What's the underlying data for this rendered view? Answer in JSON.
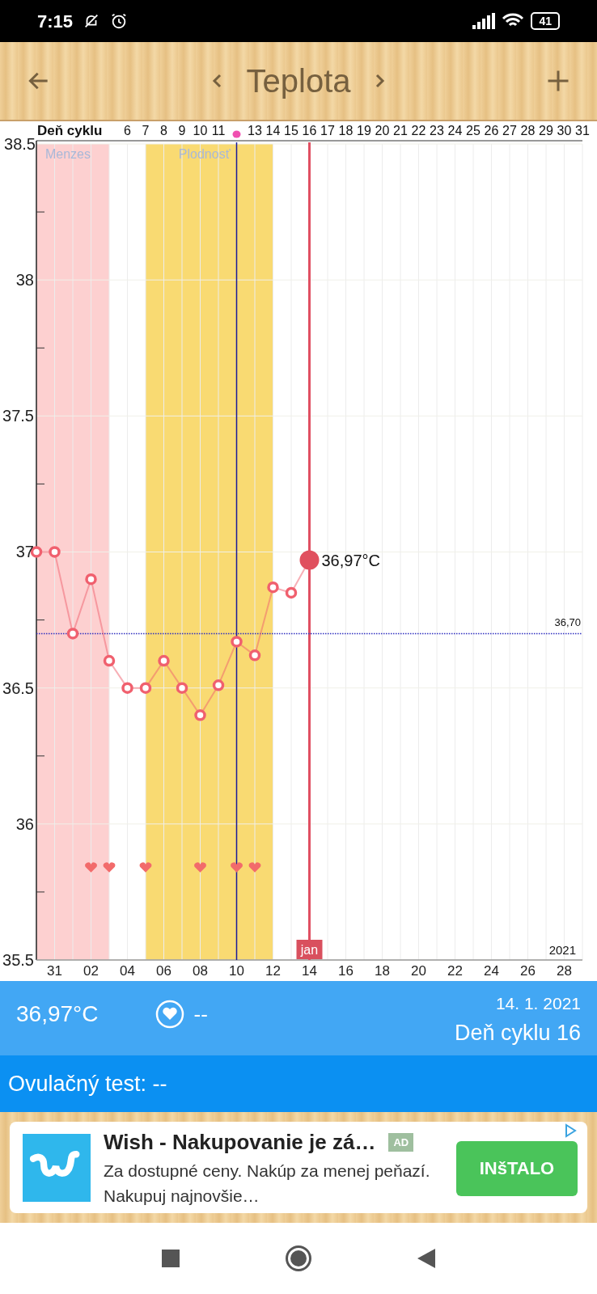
{
  "status_bar": {
    "time": "7:15",
    "battery": "41"
  },
  "header": {
    "title": "Teplota"
  },
  "chart": {
    "cycle_axis_title": "Deň cyklu",
    "cycle_day_labels": [
      {
        "kind": "number",
        "label": "6"
      },
      {
        "kind": "number",
        "label": "7"
      },
      {
        "kind": "number",
        "label": "8"
      },
      {
        "kind": "number",
        "label": "9"
      },
      {
        "kind": "number",
        "label": "10"
      },
      {
        "kind": "number",
        "label": "11"
      },
      {
        "kind": "ovulation"
      },
      {
        "kind": "number",
        "label": "13"
      },
      {
        "kind": "number",
        "label": "14"
      },
      {
        "kind": "number",
        "label": "15"
      },
      {
        "kind": "number",
        "label": "16"
      },
      {
        "kind": "number",
        "label": "17"
      },
      {
        "kind": "number",
        "label": "18"
      },
      {
        "kind": "number",
        "label": "19"
      },
      {
        "kind": "number",
        "label": "20"
      },
      {
        "kind": "number",
        "label": "21"
      },
      {
        "kind": "number",
        "label": "22"
      },
      {
        "kind": "number",
        "label": "23"
      },
      {
        "kind": "number",
        "label": "24"
      },
      {
        "kind": "number",
        "label": "25"
      },
      {
        "kind": "number",
        "label": "26"
      },
      {
        "kind": "number",
        "label": "27"
      },
      {
        "kind": "number",
        "label": "28"
      },
      {
        "kind": "number",
        "label": "29"
      },
      {
        "kind": "number",
        "label": "30"
      },
      {
        "kind": "number",
        "label": "31"
      }
    ],
    "month_marker": "jan",
    "year": "2021",
    "chart_data": {
      "type": "line",
      "categories": [
        null,
        "31",
        null,
        "02",
        null,
        "04",
        null,
        "06",
        null,
        "08",
        null,
        "10",
        null,
        "12",
        null,
        "14",
        null,
        "16",
        null,
        "18",
        null,
        "20",
        null,
        "22",
        null,
        "24",
        null,
        "26",
        null,
        "28",
        null
      ],
      "grid": true,
      "series": [
        {
          "color": "#f0606e",
          "marker": "circle",
          "values": [
            37.0,
            37.0,
            36.7,
            36.9,
            36.6,
            36.5,
            36.5,
            36.6,
            36.5,
            36.4,
            36.51,
            36.67,
            36.62,
            36.87,
            36.85,
            36.97,
            null,
            null,
            null,
            null,
            null,
            null,
            null,
            null,
            null,
            null,
            null,
            null,
            null,
            null,
            null
          ]
        },
        {
          "type": "scatter",
          "color": "#f26b6b",
          "values": [
            null,
            null,
            null,
            35.84,
            35.84,
            null,
            35.84,
            null,
            null,
            35.84,
            null,
            35.84,
            35.84,
            null,
            null,
            null,
            null,
            null,
            null,
            null,
            null,
            null,
            null,
            null,
            null,
            null,
            null,
            null,
            null,
            null,
            null
          ]
        }
      ],
      "ylim": [
        35.5,
        38.5
      ],
      "yticks": [
        {
          "value": 38.5,
          "label": "38.5"
        },
        {
          "value": 38,
          "label": "38"
        },
        {
          "value": 37.5,
          "label": "37.5"
        },
        {
          "value": 37,
          "label": "37"
        },
        {
          "value": 36.5,
          "label": "36.5"
        },
        {
          "value": 36,
          "label": "36"
        },
        {
          "value": 35.5,
          "label": "35.5"
        }
      ],
      "ref_lines": [
        {
          "axis": "x",
          "value": "10",
          "color": "#1a1a9a"
        },
        {
          "axis": "x",
          "value": "14",
          "color": "#e05062"
        },
        {
          "axis": "y",
          "value": 36.7,
          "label": "36,70",
          "color": "#3030c0"
        }
      ],
      "annotations": [
        {
          "text": "36,97°C"
        }
      ]
    },
    "phases": [
      {
        "label": "Menzes",
        "color": "#fdd0d0"
      },
      {
        "label": "Plodnosť",
        "color": "#f9da72"
      }
    ]
  },
  "summary": {
    "temperature": "36,97°C",
    "intercourse": "--",
    "date": "14. 1. 2021",
    "cycle_day": "Deň cyklu 16"
  },
  "ovulation_test": {
    "text": "Ovulačný test: --"
  },
  "ad": {
    "title": "Wish - Nakupovanie je zá…",
    "badge": "AD",
    "body": "Za dostupné ceny. Nakúp za menej peňazí. Nakupuj najnovšie…",
    "button": "INšTALO"
  }
}
